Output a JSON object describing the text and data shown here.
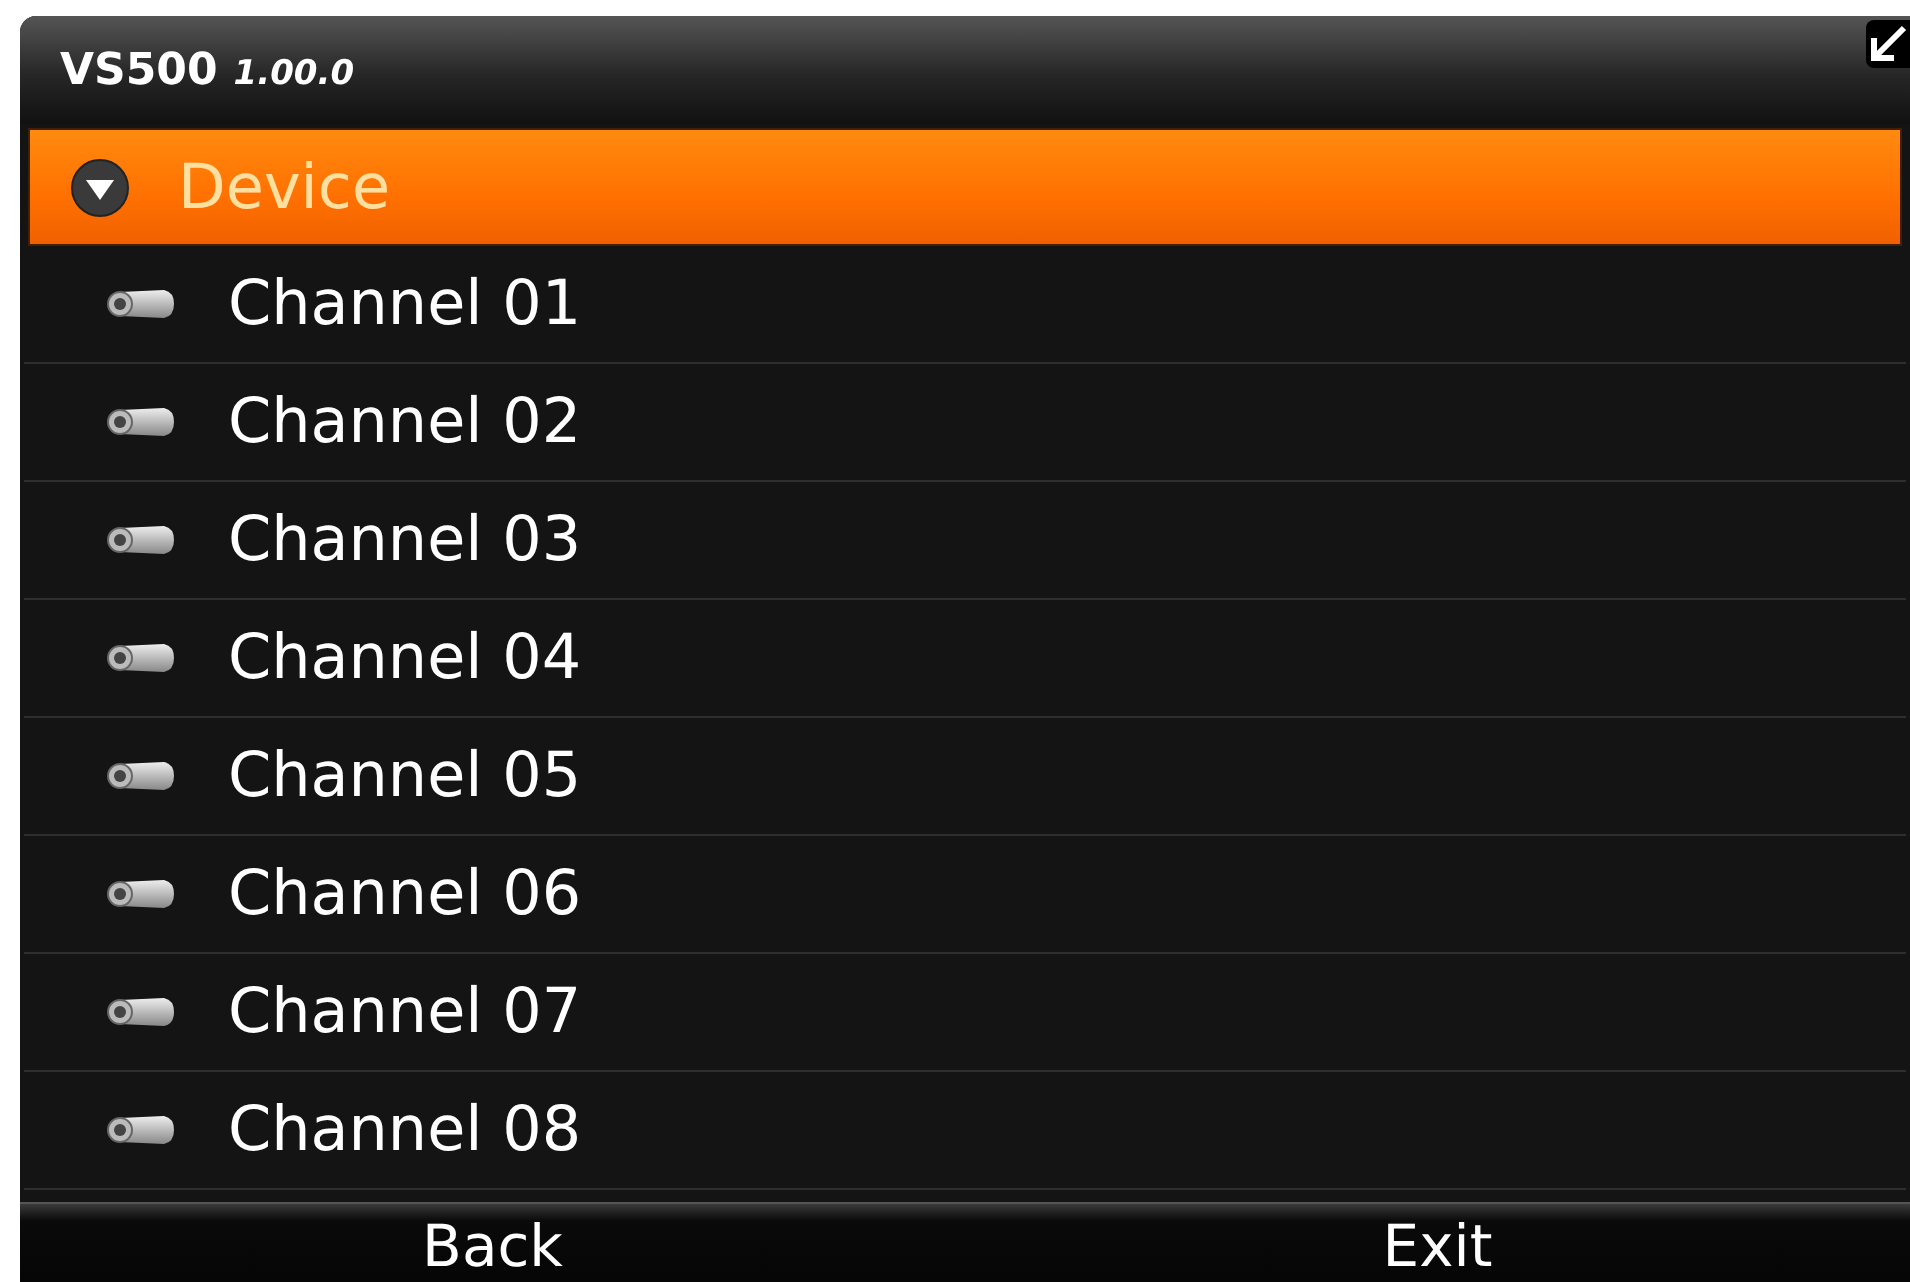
{
  "window": {
    "title": "VS500",
    "version": "1.00.0"
  },
  "tree": [
    {
      "label": "Device",
      "expanded": true,
      "selected": true,
      "children": [
        {
          "label": "Channel 01",
          "selected": false
        },
        {
          "label": "Channel 02",
          "selected": false
        },
        {
          "label": "Channel 03",
          "selected": false
        },
        {
          "label": "Channel 04",
          "selected": false
        },
        {
          "label": "Channel 05",
          "selected": false
        },
        {
          "label": "Channel 06",
          "selected": false
        },
        {
          "label": "Channel 07",
          "selected": false
        },
        {
          "label": "Channel 08",
          "selected": false
        }
      ]
    }
  ],
  "softkeys": [
    "Back",
    "Exit"
  ]
}
